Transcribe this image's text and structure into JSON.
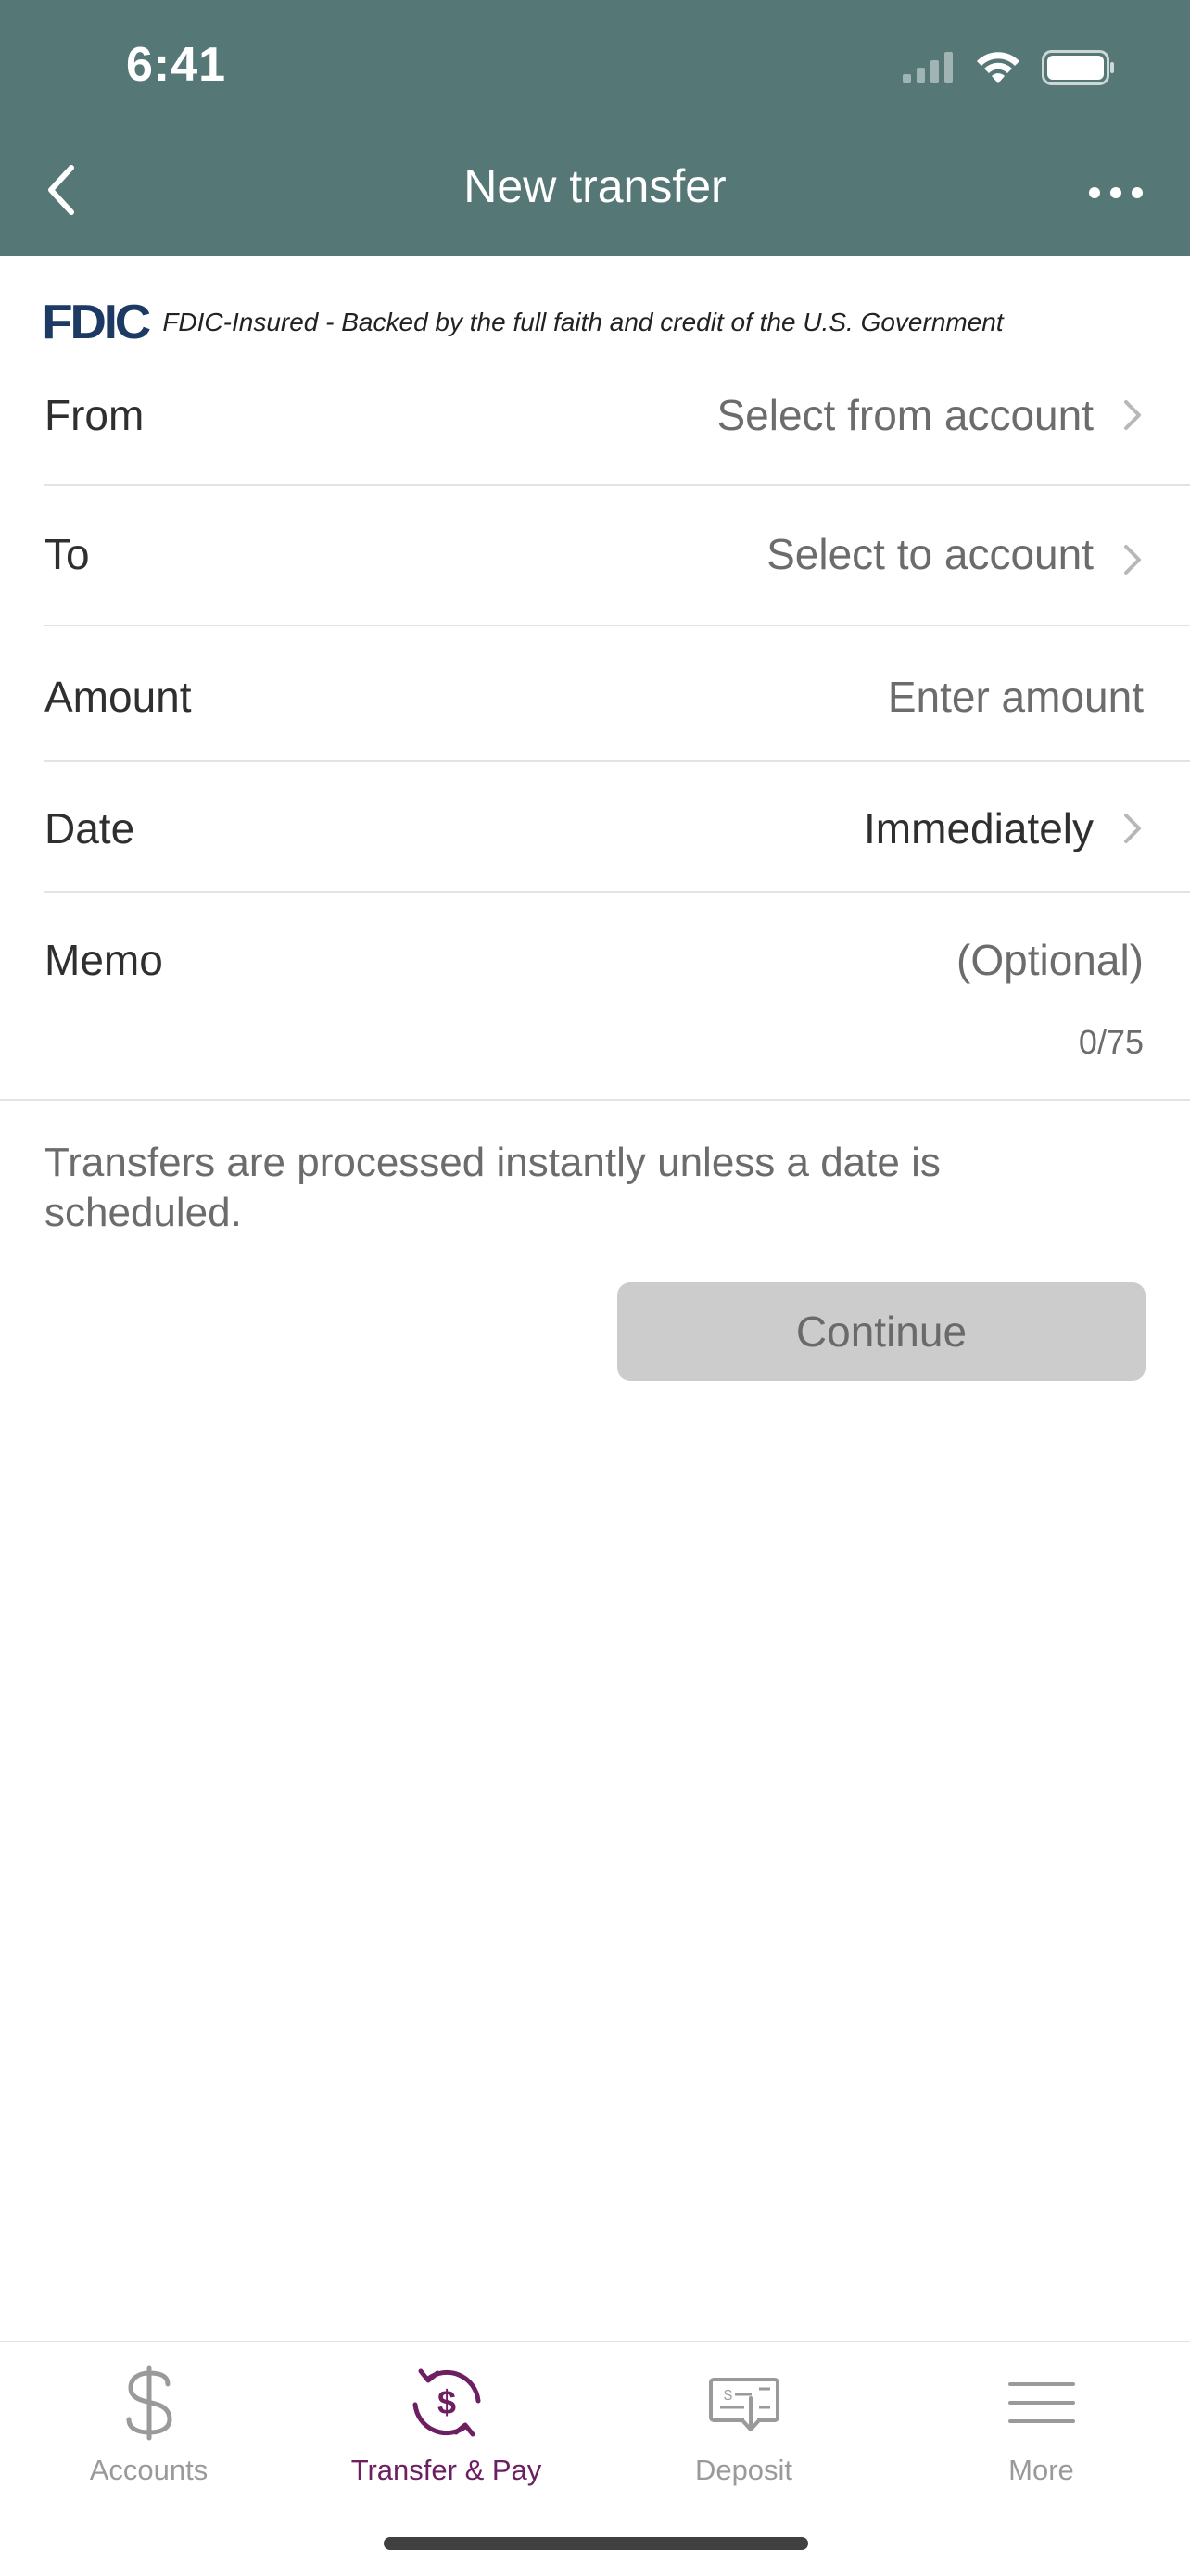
{
  "status_bar": {
    "time": "6:41"
  },
  "nav": {
    "title": "New transfer"
  },
  "fdic": {
    "logo": "FDIC",
    "text": "FDIC-Insured - Backed by the full faith and credit of the U.S. Government"
  },
  "form": {
    "from": {
      "label": "From",
      "value": "Select from account"
    },
    "to": {
      "label": "To",
      "value": "Select to account"
    },
    "amount": {
      "label": "Amount",
      "placeholder": "Enter amount"
    },
    "date": {
      "label": "Date",
      "value": "Immediately"
    },
    "memo": {
      "label": "Memo",
      "placeholder": "(Optional)",
      "counter": "0/75"
    }
  },
  "info": {
    "text": "Transfers are processed instantly unless a date is scheduled."
  },
  "actions": {
    "continue_label": "Continue"
  },
  "tabbar": {
    "items": [
      {
        "label": "Accounts",
        "icon": "dollar-icon"
      },
      {
        "label": "Transfer & Pay",
        "icon": "transfer-dollar-icon"
      },
      {
        "label": "Deposit",
        "icon": "check-deposit-icon"
      },
      {
        "label": "More",
        "icon": "menu-icon"
      }
    ],
    "active_index": 1
  },
  "colors": {
    "header_bg": "#557877",
    "active_tab": "#6d1f62",
    "fdic_blue": "#1c3a64",
    "disabled_button": "#cccccc"
  }
}
